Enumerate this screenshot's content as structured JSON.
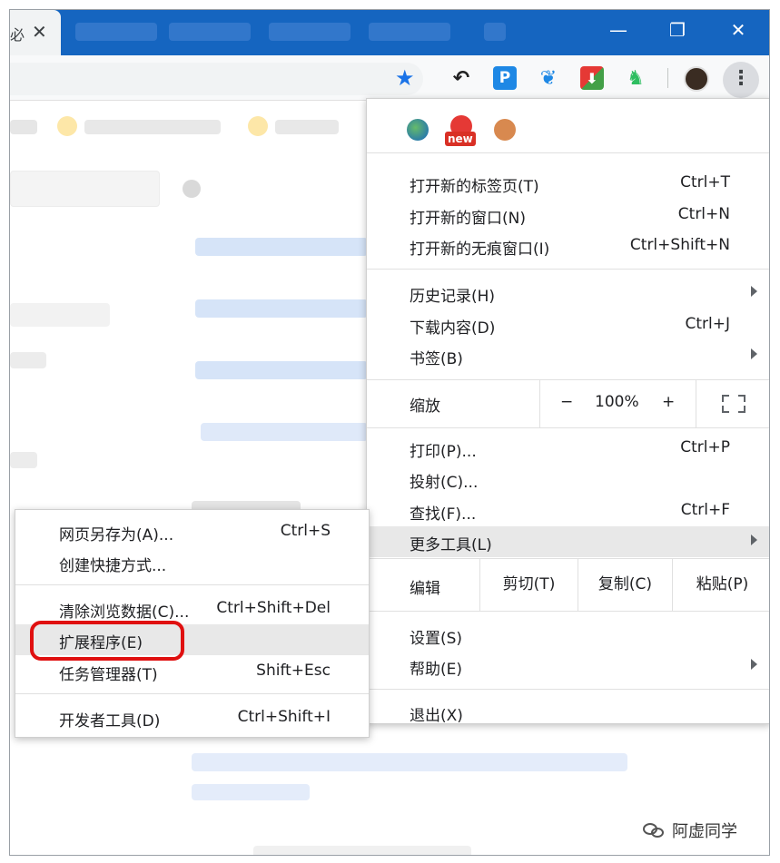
{
  "tab": {
    "title": "必"
  },
  "extensions": {
    "new_badge": "new"
  },
  "menu": {
    "group1": [
      {
        "label": "打开新的标签页(T)",
        "shortcut": "Ctrl+T"
      },
      {
        "label": "打开新的窗口(N)",
        "shortcut": "Ctrl+N"
      },
      {
        "label": "打开新的无痕窗口(I)",
        "shortcut": "Ctrl+Shift+N"
      }
    ],
    "group2": [
      {
        "label": "历史记录(H)",
        "shortcut": ""
      },
      {
        "label": "下载内容(D)",
        "shortcut": "Ctrl+J"
      },
      {
        "label": "书签(B)",
        "shortcut": ""
      }
    ],
    "zoom": {
      "label": "缩放",
      "minus": "−",
      "value": "100%",
      "plus": "+"
    },
    "group3": [
      {
        "label": "打印(P)...",
        "shortcut": "Ctrl+P"
      },
      {
        "label": "投射(C)...",
        "shortcut": ""
      },
      {
        "label": "查找(F)...",
        "shortcut": "Ctrl+F"
      },
      {
        "label": "更多工具(L)",
        "shortcut": ""
      }
    ],
    "edit": {
      "label": "编辑",
      "cut": "剪切(T)",
      "copy": "复制(C)",
      "paste": "粘贴(P)"
    },
    "group4": [
      {
        "label": "设置(S)",
        "shortcut": ""
      },
      {
        "label": "帮助(E)",
        "shortcut": ""
      }
    ],
    "exit": {
      "label": "退出(X)"
    }
  },
  "submenu": {
    "group1": [
      {
        "label": "网页另存为(A)...",
        "shortcut": "Ctrl+S"
      },
      {
        "label": "创建快捷方式...",
        "shortcut": ""
      }
    ],
    "group2": [
      {
        "label": "清除浏览数据(C)...",
        "shortcut": "Ctrl+Shift+Del"
      },
      {
        "label": "扩展程序(E)",
        "shortcut": ""
      },
      {
        "label": "任务管理器(T)",
        "shortcut": "Shift+Esc"
      }
    ],
    "group3": [
      {
        "label": "开发者工具(D)",
        "shortcut": "Ctrl+Shift+I"
      }
    ]
  },
  "watermark": {
    "text": "阿虚同学"
  },
  "colors": {
    "titlebar": "#1565c0",
    "highlight": "#e01010",
    "star": "#1a73e8"
  }
}
